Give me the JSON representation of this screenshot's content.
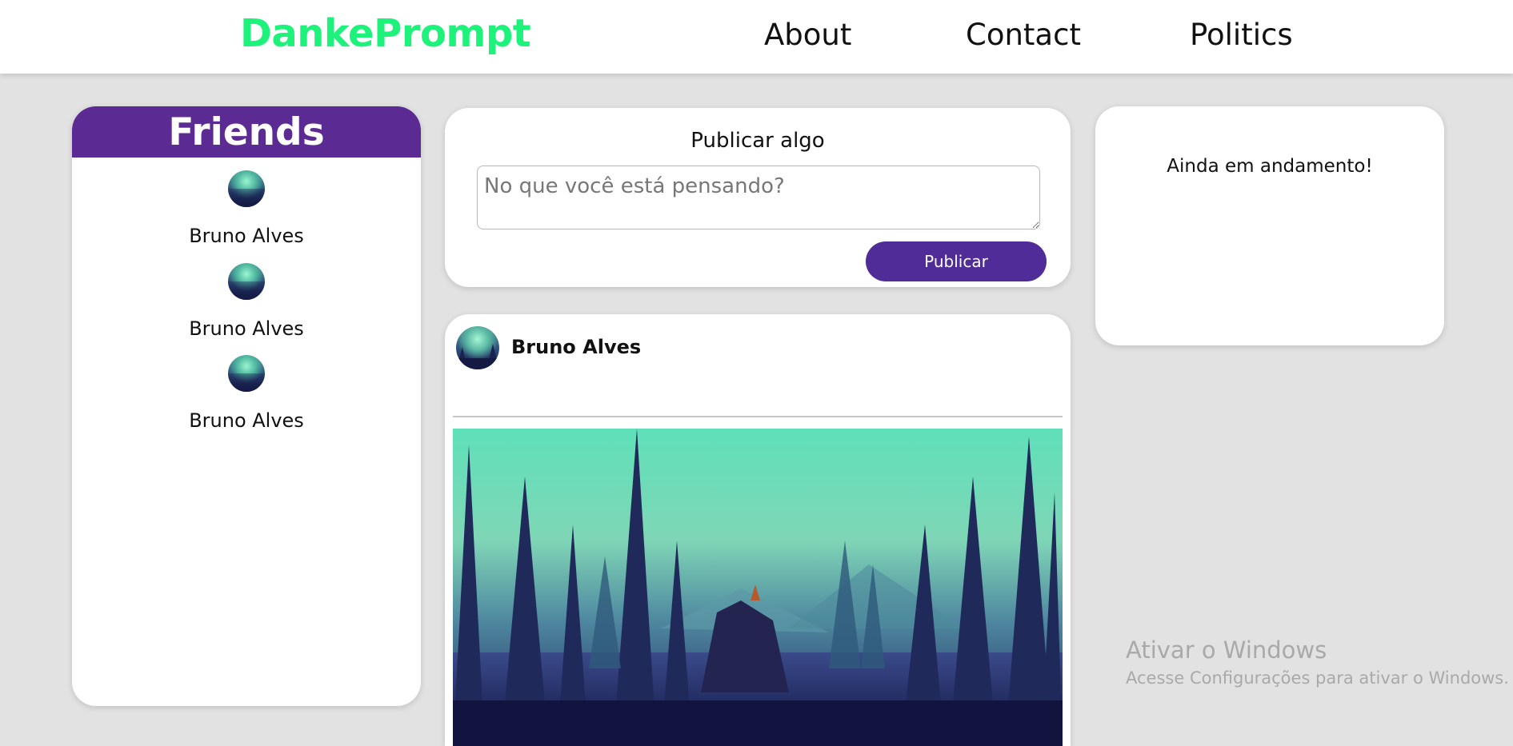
{
  "header": {
    "brand": "DankePrompt",
    "nav": [
      "About",
      "Contact",
      "Politics"
    ]
  },
  "friends": {
    "title": "Friends",
    "items": [
      {
        "name": "Bruno Alves"
      },
      {
        "name": "Bruno Alves"
      },
      {
        "name": "Bruno Alves"
      }
    ]
  },
  "composer": {
    "title": "Publicar algo",
    "placeholder": "No que você está pensando?",
    "button_label": "Publicar"
  },
  "post": {
    "author": "Bruno Alves",
    "image_icon": "forest-fox-landscape"
  },
  "side_panel": {
    "text": "Ainda em andamento!"
  },
  "watermark": {
    "title": "Ativar o Windows",
    "subtitle": "Acesse Configurações para ativar o Windows."
  },
  "colors": {
    "brand": "#1df27a",
    "purple_header": "#5b2a93",
    "button": "#4f2c97",
    "background": "#e2e2e2"
  }
}
